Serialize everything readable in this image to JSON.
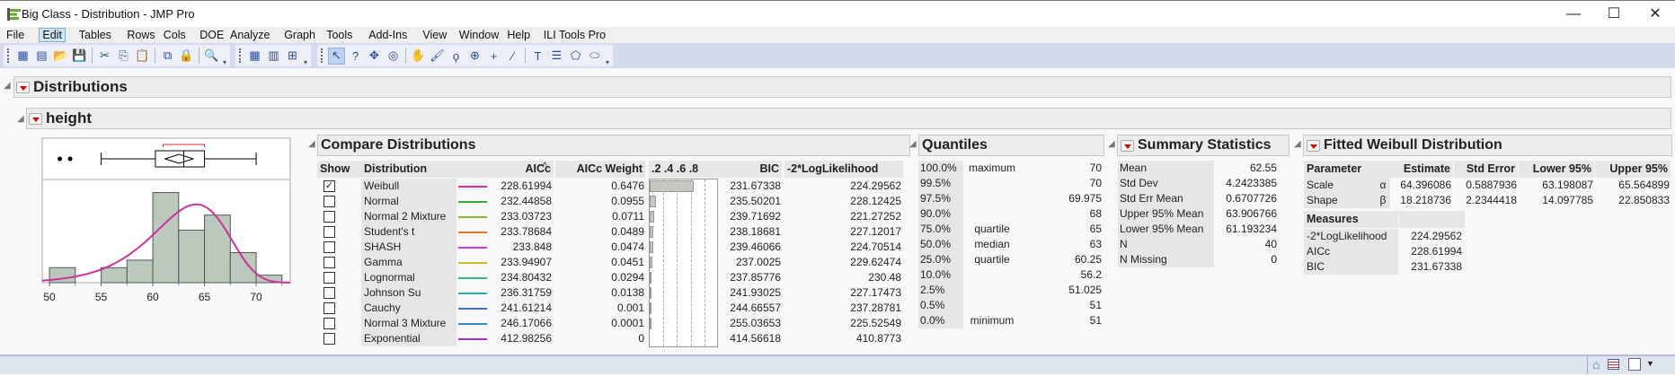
{
  "window": {
    "title": "Big Class - Distribution - JMP Pro",
    "minimize": "—",
    "maximize": "☐",
    "close": "✕"
  },
  "menu": [
    "File",
    "Edit",
    "Tables",
    "Rows",
    "Cols",
    "DOE",
    "Analyze",
    "Graph",
    "Tools",
    "Add-Ins",
    "View",
    "Window",
    "Help",
    "ILI Tools Pro"
  ],
  "menu_active": "Edit",
  "toolbar": {
    "groups": [
      [
        "new-data-table-icon",
        "new-script-icon",
        "open-icon",
        "save-icon",
        "|",
        "cut-icon",
        "copy-icon",
        "paste-icon",
        "|",
        "data-filter-icon",
        "lock-icon",
        "|",
        "search-icon"
      ],
      [
        "data-grid-icon",
        "columns-icon",
        "add-graph-icon"
      ],
      [
        "arrow-select-icon",
        "help-question-icon",
        "crosshair-icon",
        "target-icon",
        "|",
        "hand-icon",
        "brush-icon",
        "lasso-icon",
        "magnifier-icon",
        "plus-icon",
        "line-icon",
        "|",
        "text-annotate-icon",
        "arrow-icon",
        "polygon-icon",
        "ellipse-icon"
      ]
    ]
  },
  "report": {
    "title": "Distributions",
    "variable": "height",
    "compare": {
      "title": "Compare Distributions",
      "headers": {
        "show": "Show",
        "distribution": "Distribution",
        "aicc": "AICc",
        "sort_indicator": "^",
        "aicc_weight": "AICc Weight",
        "bar_axis": ".2 .4 .6 .8",
        "bic": "BIC",
        "neg2ll": "-2*LogLikelihood"
      },
      "rows": [
        {
          "show": true,
          "name": "Weibull",
          "color": "#d02f9e",
          "aicc": "228.61994",
          "weight": "0.6476",
          "w": 0.6476,
          "bic": "231.67338",
          "neg2ll": "224.29562"
        },
        {
          "show": false,
          "name": "Normal",
          "color": "#3aa83a",
          "aicc": "232.44858",
          "weight": "0.0955",
          "w": 0.0955,
          "bic": "235.50201",
          "neg2ll": "228.12425"
        },
        {
          "show": false,
          "name": "Normal 2 Mixture",
          "color": "#8db526",
          "aicc": "233.03723",
          "weight": "0.0711",
          "w": 0.0711,
          "bic": "239.71692",
          "neg2ll": "221.27252"
        },
        {
          "show": false,
          "name": "Student's t",
          "color": "#d9772a",
          "aicc": "233.78684",
          "weight": "0.0489",
          "w": 0.0489,
          "bic": "238.18681",
          "neg2ll": "227.12017"
        },
        {
          "show": false,
          "name": "SHASH",
          "color": "#c83ac8",
          "aicc": "233.848",
          "weight": "0.0474",
          "w": 0.0474,
          "bic": "239.46066",
          "neg2ll": "224.70514"
        },
        {
          "show": false,
          "name": "Gamma",
          "color": "#c9bf22",
          "aicc": "233.94907",
          "weight": "0.0451",
          "w": 0.0451,
          "bic": "237.0025",
          "neg2ll": "229.62474"
        },
        {
          "show": false,
          "name": "Lognormal",
          "color": "#2fb88a",
          "aicc": "234.80432",
          "weight": "0.0294",
          "w": 0.0294,
          "bic": "237.85776",
          "neg2ll": "230.48"
        },
        {
          "show": false,
          "name": "Johnson Su",
          "color": "#22b0b0",
          "aicc": "236.31759",
          "weight": "0.0138",
          "w": 0.0138,
          "bic": "241.93025",
          "neg2ll": "227.17473"
        },
        {
          "show": false,
          "name": "Cauchy",
          "color": "#3b6fd6",
          "aicc": "241.61214",
          "weight": "0.001",
          "w": 0.001,
          "bic": "244.66557",
          "neg2ll": "237.28781"
        },
        {
          "show": false,
          "name": "Normal 3 Mixture",
          "color": "#2a8fc0",
          "aicc": "246.17066",
          "weight": "0.0001",
          "w": 0.0001,
          "bic": "255.03653",
          "neg2ll": "225.52549"
        },
        {
          "show": false,
          "name": "Exponential",
          "color": "#a32fd6",
          "aicc": "412.98256",
          "weight": "0",
          "w": 0,
          "bic": "414.56618",
          "neg2ll": "410.8773"
        }
      ]
    },
    "quantiles": {
      "title": "Quantiles",
      "rows": [
        {
          "pct": "100.0%",
          "label": "maximum",
          "value": "70"
        },
        {
          "pct": "99.5%",
          "label": "",
          "value": "70"
        },
        {
          "pct": "97.5%",
          "label": "",
          "value": "69.975"
        },
        {
          "pct": "90.0%",
          "label": "",
          "value": "68"
        },
        {
          "pct": "75.0%",
          "label": "quartile",
          "value": "65"
        },
        {
          "pct": "50.0%",
          "label": "median",
          "value": "63"
        },
        {
          "pct": "25.0%",
          "label": "quartile",
          "value": "60.25"
        },
        {
          "pct": "10.0%",
          "label": "",
          "value": "56.2"
        },
        {
          "pct": "2.5%",
          "label": "",
          "value": "51.025"
        },
        {
          "pct": "0.5%",
          "label": "",
          "value": "51"
        },
        {
          "pct": "0.0%",
          "label": "minimum",
          "value": "51"
        }
      ]
    },
    "summary": {
      "title": "Summary Statistics",
      "rows": [
        {
          "label": "Mean",
          "value": "62.55"
        },
        {
          "label": "Std Dev",
          "value": "4.2423385"
        },
        {
          "label": "Std Err Mean",
          "value": "0.6707726"
        },
        {
          "label": "Upper 95% Mean",
          "value": "63.906766"
        },
        {
          "label": "Lower 95% Mean",
          "value": "61.193234"
        },
        {
          "label": "N",
          "value": "40"
        },
        {
          "label": "N Missing",
          "value": "0"
        }
      ]
    },
    "fitted": {
      "title": "Fitted Weibull Distribution",
      "headers": {
        "parameter": "Parameter",
        "estimate": "Estimate",
        "stderr": "Std Error",
        "lower": "Lower 95%",
        "upper": "Upper 95%"
      },
      "params": [
        {
          "name": "Scale",
          "sym": "α",
          "estimate": "64.396086",
          "stderr": "0.5887936",
          "lower": "63.198087",
          "upper": "65.564899"
        },
        {
          "name": "Shape",
          "sym": "β",
          "estimate": "18.218736",
          "stderr": "2.2344418",
          "lower": "14.097785",
          "upper": "22.850833"
        }
      ],
      "measures_title": "Measures",
      "measures": [
        {
          "label": "-2*LogLikelihood",
          "value": "224.29562"
        },
        {
          "label": "AICc",
          "value": "228.61994"
        },
        {
          "label": "BIC",
          "value": "231.67338"
        }
      ]
    }
  },
  "chart_data": {
    "type": "bar",
    "title": "height",
    "bin_edges": [
      50,
      52.5,
      55,
      57.5,
      60,
      62.5,
      65,
      67.5,
      70,
      72.5
    ],
    "counts": [
      2,
      0,
      2,
      3,
      12,
      7,
      9,
      4,
      1
    ],
    "xlim": [
      49.3,
      73.3
    ],
    "x_ticks": [
      "50",
      "55",
      "60",
      "65",
      "70"
    ],
    "fit_curve": {
      "name": "Weibull",
      "scale": 64.396086,
      "shape": 18.218736,
      "color": "#d02f9e"
    },
    "boxplot": {
      "min_whisker": 55,
      "q1": 60.25,
      "median": 63,
      "q3": 65,
      "max_whisker": 70,
      "outliers": [
        51,
        52
      ],
      "mean": 62.55,
      "mean_ci": [
        61.193234,
        63.906766
      ],
      "shortest_half": [
        61,
        65
      ]
    },
    "bar_color": "#bac9bb"
  },
  "statusbar": {
    "icons": [
      "home-icon",
      "data-table-icon",
      "color-swatch",
      "dropdown-arrow-icon"
    ]
  }
}
